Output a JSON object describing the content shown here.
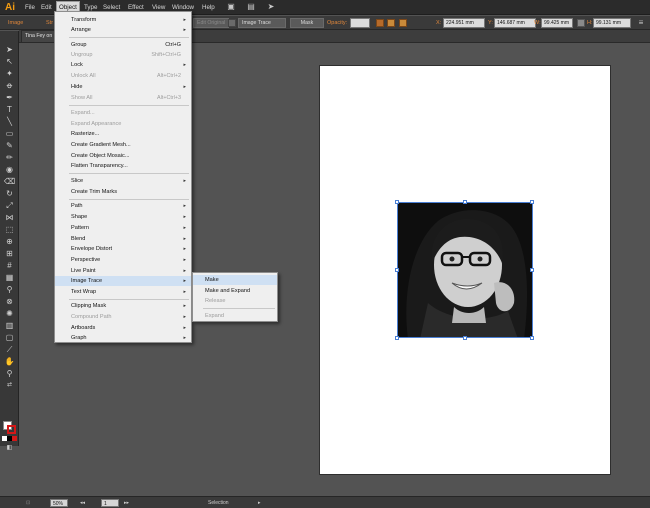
{
  "app": {
    "logo": "Ai"
  },
  "menubar": {
    "items": [
      {
        "label": "File"
      },
      {
        "label": "Edit"
      },
      {
        "label": "Object"
      },
      {
        "label": "Type"
      },
      {
        "label": "Select"
      },
      {
        "label": "Effect"
      },
      {
        "label": "View"
      },
      {
        "label": "Window"
      },
      {
        "label": "Help"
      }
    ],
    "active": "Object"
  },
  "controlbar": {
    "image_label": "Image",
    "stroke_label": "Str",
    "edit_original": "Edit Original",
    "image_trace": "Image Trace",
    "mask": "Mask",
    "opacity_label": "Opacity:",
    "x_label": "X:",
    "x_value": "224.951 mm",
    "y_label": "Y:",
    "y_value": "146.687 mm",
    "w_label": "W:",
    "w_value": "99.425 mm",
    "h_label": "H:",
    "h_value": "99.131 mm"
  },
  "document": {
    "tab_label": "Tina Fey on"
  },
  "object_menu": {
    "items": [
      {
        "label": "Transform",
        "shortcut": "",
        "submenu": true,
        "disabled": false
      },
      {
        "label": "Arrange",
        "shortcut": "",
        "submenu": true,
        "disabled": false
      },
      {
        "label": "Group",
        "shortcut": "Ctrl+G",
        "submenu": false,
        "disabled": false
      },
      {
        "label": "Ungroup",
        "shortcut": "Shift+Ctrl+G",
        "submenu": false,
        "disabled": true
      },
      {
        "label": "Lock",
        "shortcut": "",
        "submenu": true,
        "disabled": false
      },
      {
        "label": "Unlock All",
        "shortcut": "Alt+Ctrl+2",
        "submenu": false,
        "disabled": true
      },
      {
        "label": "Hide",
        "shortcut": "",
        "submenu": true,
        "disabled": false
      },
      {
        "label": "Show All",
        "shortcut": "Alt+Ctrl+3",
        "submenu": false,
        "disabled": true
      },
      {
        "label": "Expand...",
        "shortcut": "",
        "submenu": false,
        "disabled": true
      },
      {
        "label": "Expand Appearance",
        "shortcut": "",
        "submenu": false,
        "disabled": true
      },
      {
        "label": "Rasterize...",
        "shortcut": "",
        "submenu": false,
        "disabled": false
      },
      {
        "label": "Create Gradient Mesh...",
        "shortcut": "",
        "submenu": false,
        "disabled": false
      },
      {
        "label": "Create Object Mosaic...",
        "shortcut": "",
        "submenu": false,
        "disabled": false
      },
      {
        "label": "Flatten Transparency...",
        "shortcut": "",
        "submenu": false,
        "disabled": false
      },
      {
        "label": "Slice",
        "shortcut": "",
        "submenu": true,
        "disabled": false
      },
      {
        "label": "Create Trim Marks",
        "shortcut": "",
        "submenu": false,
        "disabled": false
      },
      {
        "label": "Path",
        "shortcut": "",
        "submenu": true,
        "disabled": false
      },
      {
        "label": "Shape",
        "shortcut": "",
        "submenu": true,
        "disabled": false
      },
      {
        "label": "Pattern",
        "shortcut": "",
        "submenu": true,
        "disabled": false
      },
      {
        "label": "Blend",
        "shortcut": "",
        "submenu": true,
        "disabled": false
      },
      {
        "label": "Envelope Distort",
        "shortcut": "",
        "submenu": true,
        "disabled": false
      },
      {
        "label": "Perspective",
        "shortcut": "",
        "submenu": true,
        "disabled": false
      },
      {
        "label": "Live Paint",
        "shortcut": "",
        "submenu": true,
        "disabled": false
      },
      {
        "label": "Image Trace",
        "shortcut": "",
        "submenu": true,
        "disabled": false,
        "highlighted": true
      },
      {
        "label": "Text Wrap",
        "shortcut": "",
        "submenu": true,
        "disabled": false
      },
      {
        "label": "Clipping Mask",
        "shortcut": "",
        "submenu": true,
        "disabled": false
      },
      {
        "label": "Compound Path",
        "shortcut": "",
        "submenu": true,
        "disabled": true
      },
      {
        "label": "Artboards",
        "shortcut": "",
        "submenu": true,
        "disabled": false
      },
      {
        "label": "Graph",
        "shortcut": "",
        "submenu": true,
        "disabled": false
      }
    ]
  },
  "image_trace_submenu": {
    "items": [
      {
        "label": "Make",
        "disabled": false,
        "highlighted": true
      },
      {
        "label": "Make and Expand",
        "disabled": false
      },
      {
        "label": "Release",
        "disabled": true
      },
      {
        "label": "Expand",
        "disabled": true
      }
    ]
  },
  "statusbar": {
    "zoom": "50%",
    "artboard_number": "1",
    "tool_name": "Selection"
  },
  "colors": {
    "accent": "#e0873a",
    "highlight": "#cfe0f3",
    "selection": "#4a7fd4"
  }
}
